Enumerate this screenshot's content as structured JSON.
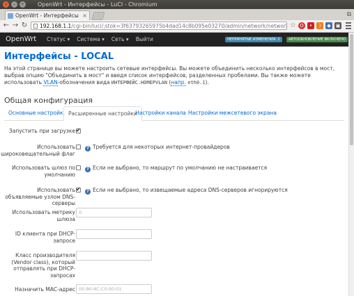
{
  "window": {
    "title": "OpenWrt - Интерфейсы - LuCI - Chromium"
  },
  "browser": {
    "tab_title": "OpenWrt - Интерфейсы",
    "url_host": "192.168.1.1",
    "url_path": "/cgi-bin/luci/;stok=3f63793265975b4dad14c8b095e03270/admin/network/network/local",
    "extension_icons": [
      "opera-icon",
      "lastpass-icon",
      "rss-icon",
      "shield-icon",
      "camera-icon"
    ]
  },
  "header": {
    "brand": "OpenWrt",
    "nav": [
      {
        "label": "Статус ▾"
      },
      {
        "label": "Система ▾"
      },
      {
        "label": "Сеть ▾"
      },
      {
        "label": "Выйти"
      }
    ],
    "badge_changes": "НЕПРИНЯТЫЕ ИЗМЕНЕНИЯ: 2",
    "badge_autorefresh": "АВТООБНОВЛЕНИЕ ВКЛЮЧЕНО"
  },
  "page": {
    "title": "Интерфейсы - LOCAL",
    "desc_part1": "На этой странице вы можете настроить сетевые интерфейсы. Вы можете объединить несколько интерфейсов в мост, выбрав опцию \"Объединить в мост\" и введя список интерфейсов, разделенных пробелами. Вы также можете использовать ",
    "desc_vlan": "VLAN",
    "desc_part2": "-обозначения вида ",
    "desc_code": "ИНТЕРФЕЙС.НОМЕРVLAN",
    "desc_part3": " (",
    "desc_example_prefix": "напр.",
    "desc_code2": "eth0.1",
    "desc_part4": ").",
    "section_title": "Общая конфигурация",
    "tabs": [
      {
        "label": "Основные настройки"
      },
      {
        "label": "Расширенные настройки"
      },
      {
        "label": "Настройки канала"
      },
      {
        "label": "Настройки межсетевого экрана"
      }
    ]
  },
  "form": {
    "autostart_label": "Запустить при загрузке",
    "autostart_checked": true,
    "broadcast_label": "Использовать широковещательный флаг",
    "broadcast_checked": false,
    "broadcast_help": "Требуется для некоторых интернет-провайдеров",
    "gateway_label": "Использовать шлюз по умолчанию",
    "gateway_checked": false,
    "gateway_help": "Если не выбрано, то маршрут по умолчанию не настраивается",
    "peerdns_label": "Использовать объявляемые узлом DNS-серверы",
    "peerdns_checked": true,
    "peerdns_help": "Если не выбрано, то извещаемые адреса DNS-серверов игнорируются",
    "metric_label": "Использовать метрику шлюза",
    "metric_placeholder": "0",
    "clientid_label": "ID клиента при DHCP-запросе",
    "vendorclass_label": "Класс производителя (Vendor class), который отправлять при DHCP-запросах",
    "macaddr_label": "Назначить MAC-адрес",
    "macaddr_placeholder": "00:90:4C:C0:00:01"
  }
}
